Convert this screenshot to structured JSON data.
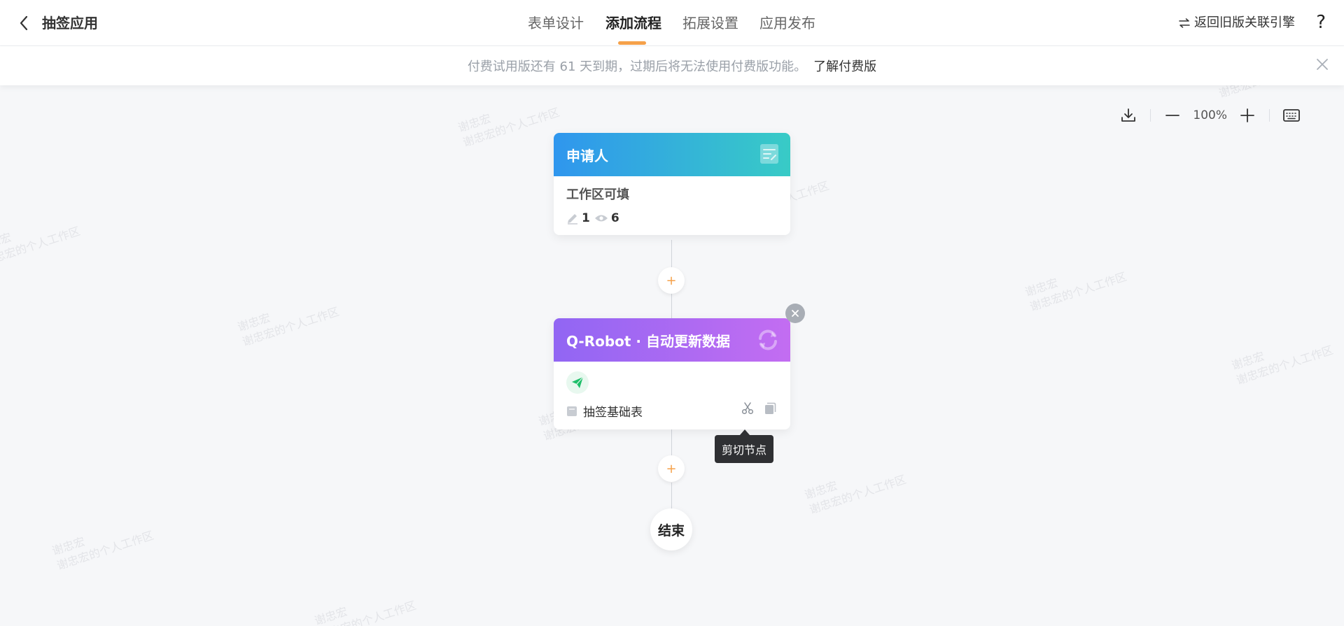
{
  "header": {
    "app_title": "抽签应用",
    "tabs": [
      {
        "label": "表单设计"
      },
      {
        "label": "添加流程"
      },
      {
        "label": "拓展设置"
      },
      {
        "label": "应用发布"
      }
    ],
    "active_tab": "添加流程",
    "switch_engine_label": "返回旧版关联引擎",
    "help_label": "?"
  },
  "banner": {
    "text": "付费试用版还有 61 天到期，过期后将无法使用付费版功能。",
    "link": "了解付费版"
  },
  "toolbar": {
    "zoom_level": "100%"
  },
  "watermark": {
    "name": "谢忠宏",
    "workspace": "谢忠宏的个人工作区"
  },
  "flow": {
    "applicant_node": {
      "title": "申请人",
      "subtitle": "工作区可填",
      "editable_count": "1",
      "visible_count": "6"
    },
    "robot_node": {
      "title": "Q-Robot · 自动更新数据",
      "table_name": "抽签基础表"
    },
    "tooltip": "剪切节点",
    "add_symbol": "+",
    "end_label": "结束"
  },
  "colors": {
    "accent": "#f5a14a",
    "applicant_gradient_start": "#2f96ee",
    "applicant_gradient_end": "#38cbc6",
    "robot_gradient_start": "#9166f3",
    "robot_gradient_end": "#c36df2"
  },
  "icons": {
    "back": "chevron-left-icon",
    "switch": "swap-icon",
    "close": "close-icon",
    "download": "download-icon",
    "zoom_out": "minus-icon",
    "zoom_in": "plus-icon",
    "keyboard": "keyboard-icon",
    "form": "form-icon",
    "refresh": "refresh-icon",
    "edit": "pencil-icon",
    "view": "eye-icon",
    "send": "paper-plane-icon",
    "table": "table-icon",
    "cut": "scissors-icon",
    "copy": "copy-icon"
  }
}
